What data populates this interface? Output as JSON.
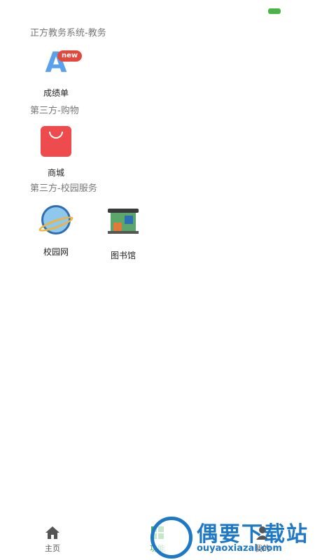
{
  "sections": [
    {
      "title": "正方教务系统-教务",
      "items": [
        {
          "label": "成绩单",
          "icon": "grade-a-icon",
          "glyph": "A",
          "badge": "new"
        }
      ]
    },
    {
      "title": "第三方-购物",
      "items": [
        {
          "label": "商城",
          "icon": "shopping-bag-icon"
        }
      ]
    },
    {
      "title": "第三方-校园服务",
      "items": [
        {
          "label": "校园网",
          "icon": "globe-icon"
        },
        {
          "label": "图书馆",
          "icon": "library-building-icon"
        }
      ]
    }
  ],
  "tabbar": {
    "items": [
      {
        "label": "主页",
        "icon": "home-icon",
        "active": false
      },
      {
        "label": "功能",
        "icon": "grid-icon",
        "active": true
      },
      {
        "label": "我的",
        "icon": "person-icon",
        "active": false
      }
    ]
  },
  "watermark": {
    "title": "偶要下载站",
    "url": "ouyaoxiazai.com"
  },
  "colors": {
    "accent": "#3fb04e",
    "section_title": "#777777",
    "badge": "#e3483d"
  }
}
